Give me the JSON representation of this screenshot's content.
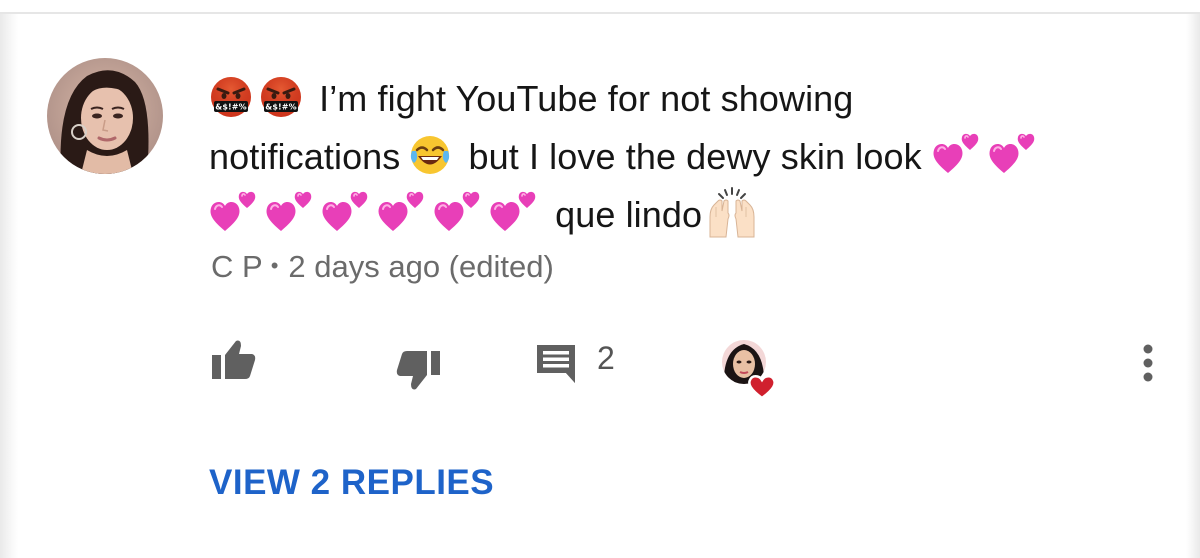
{
  "comment": {
    "author": "C P",
    "timestamp": "2 days ago (edited)",
    "separator": "•",
    "line1_text": "I’m fight YouTube for not  showing",
    "line2_text_a": "notifications",
    "line2_text_b": "but I love the dewy skin look",
    "line3_text": "que lindo",
    "emojis": [
      "face-with-symbols-on-mouth",
      "face-with-tears-of-joy",
      "two-hearts",
      "raising-hands"
    ]
  },
  "actions": {
    "reply_count": "2",
    "view_replies_label": "VIEW 2 REPLIES"
  },
  "colors": {
    "text": "#161616",
    "meta": "#6b6b6b",
    "icon": "#606060",
    "link": "#1e63c9",
    "heart": "#d0202e",
    "pink_heart": "#e83fb8"
  }
}
